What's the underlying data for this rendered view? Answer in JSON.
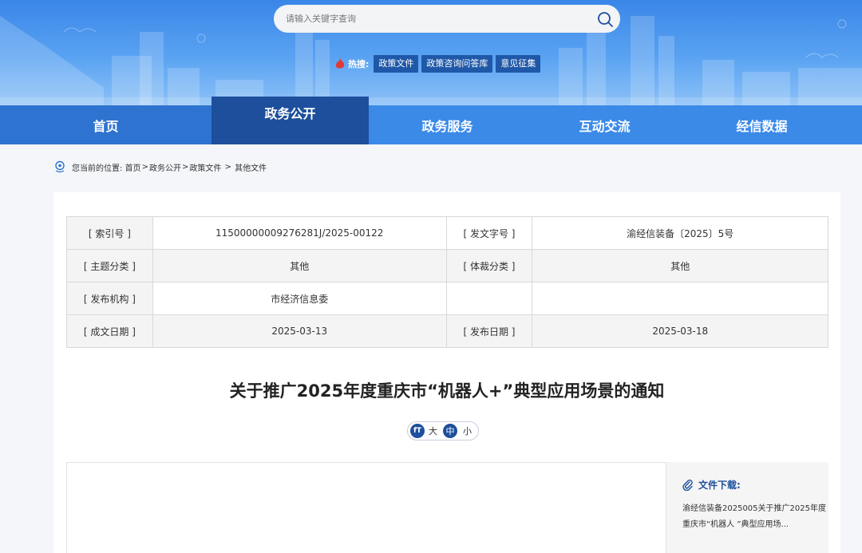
{
  "search": {
    "placeholder": "请输入关键字查询"
  },
  "hot": {
    "label": "热搜:",
    "tags": [
      "政策文件",
      "政策咨询问答库",
      "意见征集"
    ]
  },
  "nav": [
    "首页",
    "政务公开",
    "政务服务",
    "互动交流",
    "经信数据"
  ],
  "breadcrumb": {
    "prefix": "您当前的位置:",
    "items": [
      "首页",
      "政务公开",
      "政策文件",
      "其他文件"
    ],
    "separator": ">"
  },
  "meta": {
    "index_label": "[ 索引号 ]",
    "index_value": "11500000009276281J/2025-00122",
    "doc_no_label": "[ 发文字号 ]",
    "doc_no_value": "渝经信装备〔2025〕5号",
    "topic_label": "[ 主题分类 ]",
    "topic_value": "其他",
    "genre_label": "[ 体裁分类 ]",
    "genre_value": "其他",
    "issuer_label": "[ 发布机构 ]",
    "issuer_value": "市经济信息委",
    "created_label": "[ 成文日期 ]",
    "created_value": "2025-03-13",
    "published_label": "[ 发布日期 ]",
    "published_value": "2025-03-18"
  },
  "doc_title": "关于推广2025年度重庆市“机器人+”典型应用场景的通知",
  "font_size": {
    "icon": "fT",
    "large": "大",
    "medium": "中",
    "small": "小"
  },
  "download": {
    "title": "文件下载:",
    "file": "渝经信装备2025005关于推广2025年度重庆市“机器人 ”典型应用场..."
  },
  "colors": {
    "banner": "#3a86e8",
    "nav": "#3b8ae8",
    "nav_active": "#1d4f9d",
    "hot_tag": "#1f58a8"
  }
}
